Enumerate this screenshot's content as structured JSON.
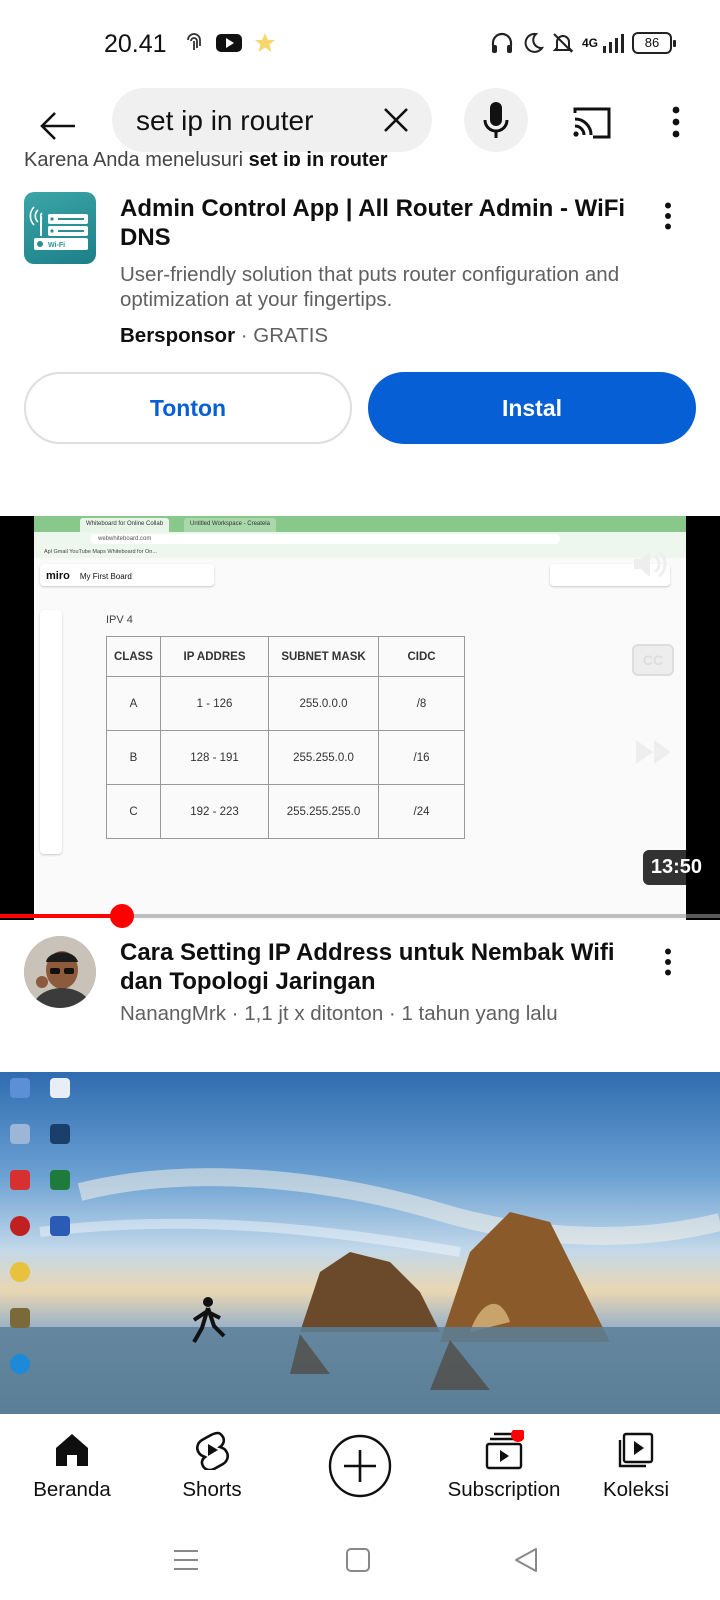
{
  "status_bar": {
    "time": "20.41",
    "network": "4G",
    "battery": "86"
  },
  "search": {
    "query": "set ip in router"
  },
  "truncated_line": {
    "prefix": "Karena Anda menelusuri ",
    "query": "set ip in router"
  },
  "ad": {
    "title": "Admin Control App | All Router Admin - WiFi DNS",
    "description": "User-friendly solution that puts router configuration and optimization at your fingertips.",
    "sponsor_label": "Bersponsor",
    "separator": " · ",
    "price": "GRATIS",
    "watch_label": "Tonton",
    "install_label": "Instal",
    "icon_label": "Wi-Fi"
  },
  "video1": {
    "title": "Cara Setting IP Address untuk Nembak Wifi dan Topologi Jaringan",
    "channel": "NanangMrk",
    "views": "1,1 jt x ditonton",
    "age": "1 tahun yang lalu",
    "duration": "13:50",
    "cc_label": "CC",
    "progress_fraction": 0.17,
    "thumbnail": {
      "tab1": "Whiteboard for Online Collab",
      "tab2": "Untitled Workspace - Createla",
      "url": "webwhiteboard.com",
      "bookmarks": "Apl   Gmail   YouTube   Maps   Whiteboard for On...",
      "app_name": "miro",
      "board_name": "My First Board",
      "heading": "IPV 4",
      "table_headers": [
        "CLASS",
        "IP ADDRES",
        "SUBNET MASK",
        "CIDC"
      ],
      "table_rows": [
        [
          "A",
          "1 - 126",
          "255.0.0.0",
          "/8"
        ],
        [
          "B",
          "128 - 191",
          "255.255.0.0",
          "/16"
        ],
        [
          "C",
          "192 - 223",
          "255.255.255.0",
          "/24"
        ]
      ]
    }
  },
  "bottom_nav": {
    "items": [
      {
        "label": "Beranda"
      },
      {
        "label": "Shorts"
      },
      {
        "label": "Subscription"
      },
      {
        "label": "Koleksi"
      }
    ]
  },
  "colors": {
    "accent_blue": "#065fd4",
    "progress_red": "#ff0000",
    "secondary_text": "#606060"
  }
}
